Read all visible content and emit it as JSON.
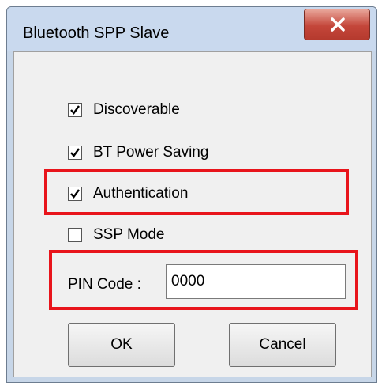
{
  "window": {
    "title": "Bluetooth SPP Slave"
  },
  "options": [
    {
      "label": "Discoverable",
      "checked": true
    },
    {
      "label": "BT Power Saving",
      "checked": true
    },
    {
      "label": "Authentication",
      "checked": true,
      "highlighted": true
    },
    {
      "label": "SSP Mode",
      "checked": false
    }
  ],
  "pin": {
    "label": "PIN Code :",
    "value": "0000",
    "highlighted": true
  },
  "buttons": {
    "ok": "OK",
    "cancel": "Cancel"
  },
  "colors": {
    "highlight": "#e8141b",
    "titlebar": "#c9d9ee",
    "close_button": "#c4463a"
  },
  "icons": {
    "close": "close-icon",
    "checkmark": "checkmark-icon"
  }
}
